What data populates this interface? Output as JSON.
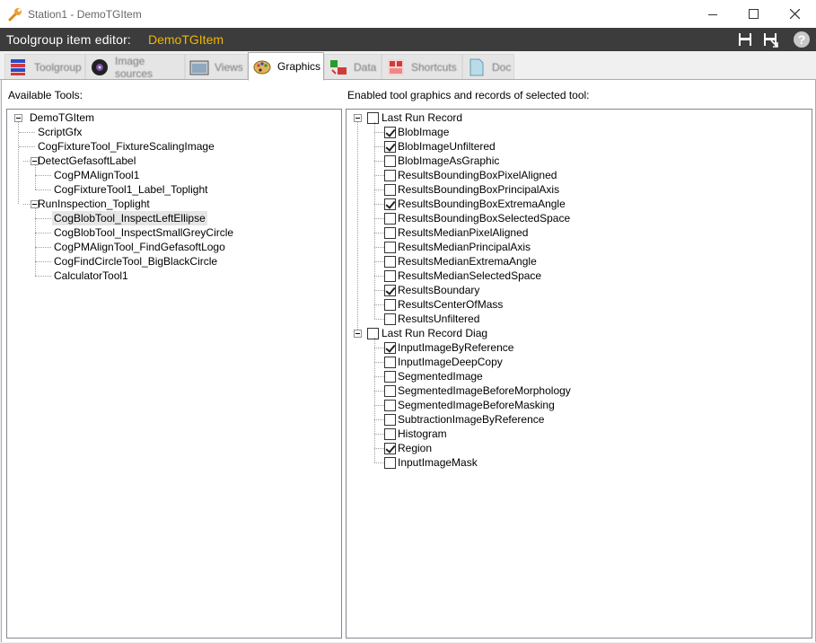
{
  "window": {
    "title": "Station1 - DemoTGItem",
    "icon": "wrench-icon"
  },
  "header": {
    "label": "Toolgroup item editor:",
    "item_name": "DemoTGItem"
  },
  "tabs": [
    {
      "label": "Toolgroup",
      "icon": "toolgroup-icon",
      "active": false
    },
    {
      "label": "Image sources",
      "icon": "image-sources-icon",
      "active": false
    },
    {
      "label": "Views",
      "icon": "views-icon",
      "active": false
    },
    {
      "label": "Graphics",
      "icon": "palette-icon",
      "active": true
    },
    {
      "label": "Data",
      "icon": "data-icon",
      "active": false
    },
    {
      "label": "Shortcuts",
      "icon": "shortcuts-icon",
      "active": false
    },
    {
      "label": "Doc",
      "icon": "doc-icon",
      "active": false
    }
  ],
  "left_panel": {
    "label": "Available Tools:",
    "tree": [
      {
        "label": "DemoTGItem",
        "level": 0,
        "expander": true
      },
      {
        "label": "ScriptGfx",
        "level": 1
      },
      {
        "label": "CogFixtureTool_FixtureScalingImage",
        "level": 1
      },
      {
        "label": "DetectGefasoftLabel",
        "level": 1,
        "expander": true
      },
      {
        "label": "CogPMAlignTool1",
        "level": 2
      },
      {
        "label": "CogFixtureTool1_Label_Toplight",
        "level": 2
      },
      {
        "label": "RunInspection_Toplight",
        "level": 1,
        "expander": true
      },
      {
        "label": "CogBlobTool_InspectLeftEllipse",
        "level": 2,
        "selected": true
      },
      {
        "label": "CogBlobTool_InspectSmallGreyCircle",
        "level": 2
      },
      {
        "label": "CogPMAlignTool_FindGefasoftLogo",
        "level": 2
      },
      {
        "label": "CogFindCircleTool_BigBlackCircle",
        "level": 2
      },
      {
        "label": "CalculatorTool1",
        "level": 2
      }
    ]
  },
  "right_panel": {
    "label": "Enabled tool graphics and records of selected tool:",
    "groups": [
      {
        "label": "Last Run Record",
        "checked": false,
        "items": [
          {
            "label": "BlobImage",
            "checked": true
          },
          {
            "label": "BlobImageUnfiltered",
            "checked": true
          },
          {
            "label": "BlobImageAsGraphic",
            "checked": false
          },
          {
            "label": "ResultsBoundingBoxPixelAligned",
            "checked": false
          },
          {
            "label": "ResultsBoundingBoxPrincipalAxis",
            "checked": false
          },
          {
            "label": "ResultsBoundingBoxExtremaAngle",
            "checked": true
          },
          {
            "label": "ResultsBoundingBoxSelectedSpace",
            "checked": false
          },
          {
            "label": "ResultsMedianPixelAligned",
            "checked": false
          },
          {
            "label": "ResultsMedianPrincipalAxis",
            "checked": false
          },
          {
            "label": "ResultsMedianExtremaAngle",
            "checked": false
          },
          {
            "label": "ResultsMedianSelectedSpace",
            "checked": false
          },
          {
            "label": "ResultsBoundary",
            "checked": true
          },
          {
            "label": "ResultsCenterOfMass",
            "checked": false
          },
          {
            "label": "ResultsUnfiltered",
            "checked": false
          }
        ]
      },
      {
        "label": "Last Run Record Diag",
        "checked": false,
        "items": [
          {
            "label": "InputImageByReference",
            "checked": true
          },
          {
            "label": "InputImageDeepCopy",
            "checked": false
          },
          {
            "label": "SegmentedImage",
            "checked": false
          },
          {
            "label": "SegmentedImageBeforeMorphology",
            "checked": false
          },
          {
            "label": "SegmentedImageBeforeMasking",
            "checked": false
          },
          {
            "label": "SubtractionImageByReference",
            "checked": false
          },
          {
            "label": "Histogram",
            "checked": false
          },
          {
            "label": "Region",
            "checked": true
          },
          {
            "label": "InputImageMask",
            "checked": false
          }
        ]
      }
    ]
  }
}
